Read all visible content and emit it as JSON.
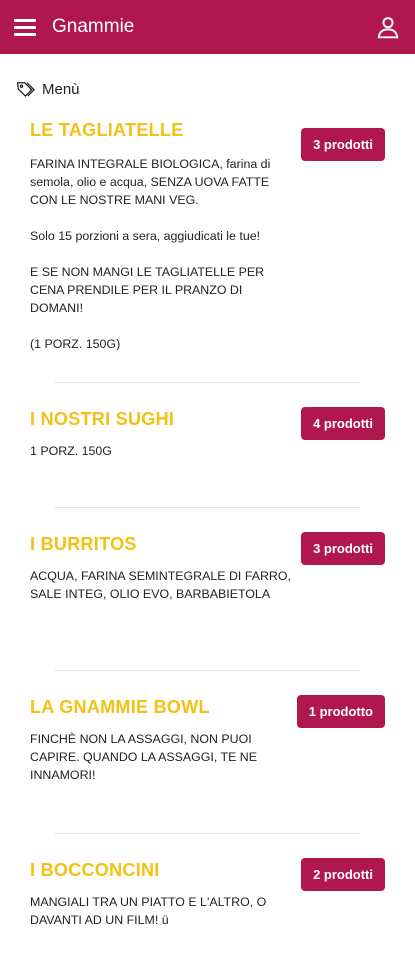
{
  "appbar": {
    "title": "Gnammie"
  },
  "section": {
    "label": "Menù"
  },
  "items": [
    {
      "title": "LE TAGLIATELLE",
      "desc": "FARINA INTEGRALE BIOLOGICA, farina di semola, olio e acqua, SENZA UOVA FATTE CON LE NOSTRE MANI VEG.\n\nSolo 15 porzioni a sera, aggiudicati le tue!\n\nE SE NON MANGI LE TAGLIATELLE PER CENA PRENDILE PER IL PRANZO DI DOMANI!\n\n(1 PORZ. 150G)",
      "button": "3 prodotti"
    },
    {
      "title": "I NOSTRI SUGHI",
      "desc": "1 PORZ. 150G",
      "button": "4 prodotti"
    },
    {
      "title": "I BURRITOS",
      "desc": "ACQUA, FARINA SEMINTEGRALE DI FARRO, SALE INTEG, OLIO EVO, BARBABIETOLA",
      "button": "3 prodotti"
    },
    {
      "title": "LA GNAMMIE BOWL",
      "desc": "FINCHÈ NON LA ASSAGGI, NON PUOI CAPIRE. QUANDO LA ASSAGGI, TE NE INNAMORI!",
      "button": "1 prodotto"
    },
    {
      "title": "I BOCCONCINI",
      "desc": "MANGIALI TRA UN PIATTO E L'ALTRO, O DAVANTI AD UN FILM! ü",
      "button": "2 prodotti"
    }
  ]
}
